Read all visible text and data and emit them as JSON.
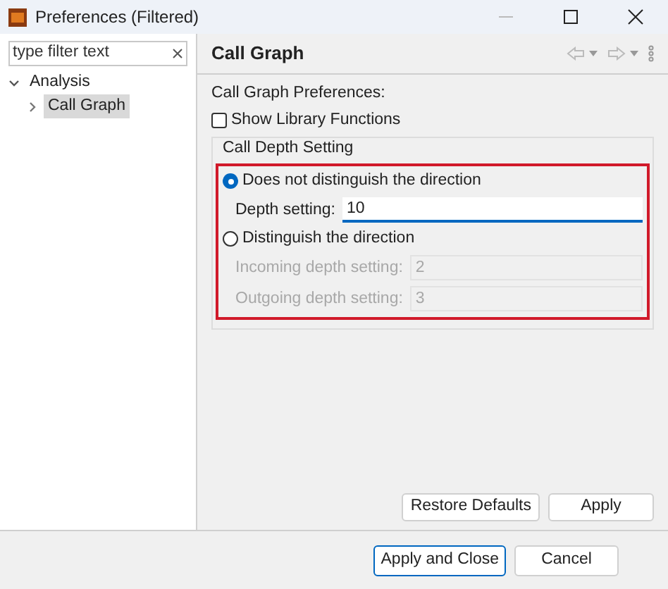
{
  "window": {
    "title": "Preferences (Filtered)"
  },
  "filter": {
    "placeholder": "type filter text"
  },
  "tree": [
    {
      "label": "Analysis",
      "expanded": true,
      "selected": false,
      "children": [
        {
          "label": "Call Graph",
          "expanded": false,
          "selected": true
        }
      ]
    }
  ],
  "page": {
    "title": "Call Graph",
    "intro": "Call Graph Preferences:",
    "show_library_functions": {
      "label": "Show Library Functions",
      "checked": false
    },
    "group": {
      "title": "Call Depth Setting",
      "highlighted": true,
      "items": [
        {
          "kind": "radio",
          "label": "Does not distinguish the direction",
          "selected": true
        },
        {
          "kind": "field",
          "label": "Depth setting:",
          "value": "10",
          "disabled": false,
          "focused": true
        },
        {
          "kind": "radio",
          "label": "Distinguish the direction",
          "selected": false
        },
        {
          "kind": "field",
          "label": "Incoming depth setting:",
          "value": "2",
          "disabled": true,
          "focused": false
        },
        {
          "kind": "field",
          "label": "Outgoing depth setting:",
          "value": "3",
          "disabled": true,
          "focused": false
        }
      ]
    }
  },
  "page_buttons": [
    {
      "label": "Restore Defaults"
    },
    {
      "label": "Apply"
    }
  ],
  "dialog_buttons": [
    {
      "label": "Apply and Close",
      "default": true
    },
    {
      "label": "Cancel",
      "default": false
    }
  ]
}
